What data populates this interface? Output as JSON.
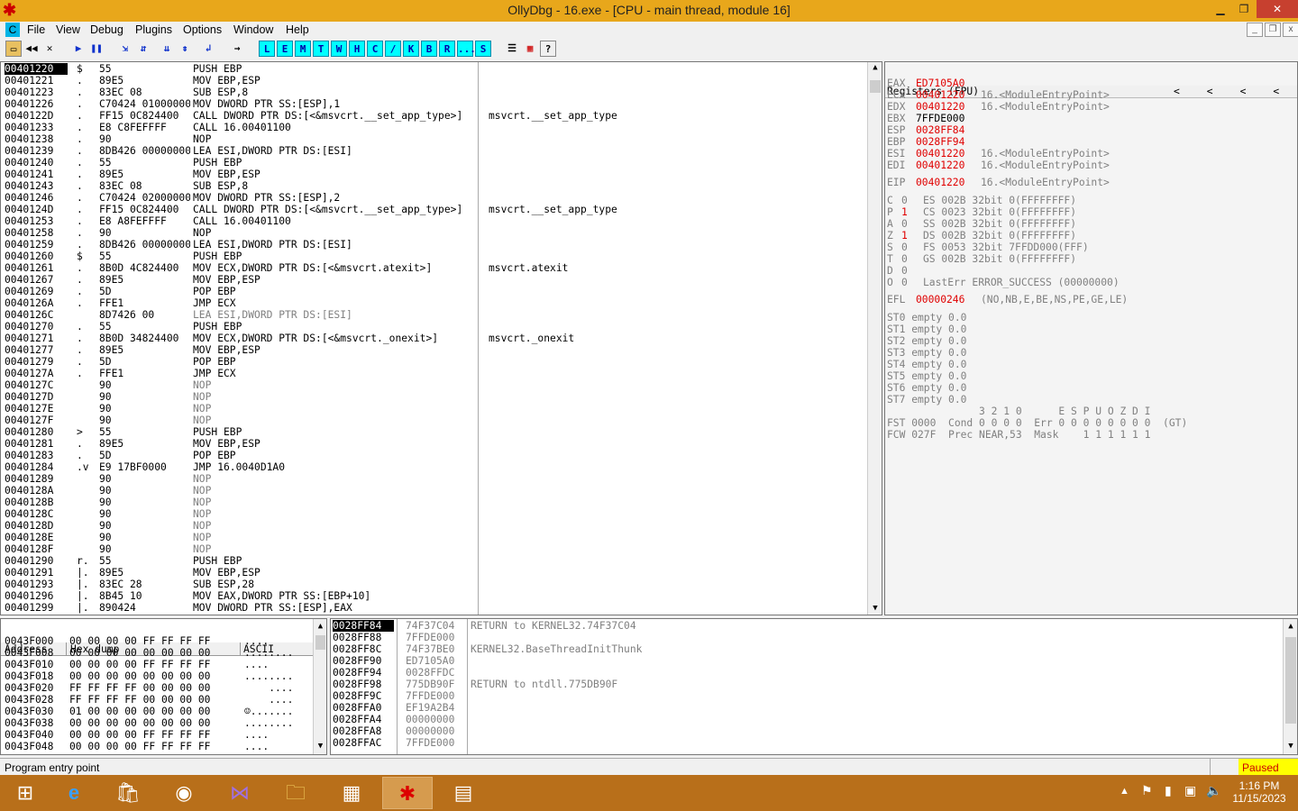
{
  "window": {
    "title": "OllyDbg - 16.exe - [CPU - main thread, module 16]"
  },
  "menu": [
    "File",
    "View",
    "Debug",
    "Plugins",
    "Options",
    "Window",
    "Help"
  ],
  "toolbar": {
    "letters": [
      "L",
      "E",
      "M",
      "T",
      "W",
      "H",
      "C",
      "/",
      "K",
      "B",
      "R",
      "...",
      "S"
    ]
  },
  "disasm": [
    [
      "00401220",
      "$",
      "55",
      "PUSH EBP",
      "",
      true
    ],
    [
      "00401221",
      ".",
      "89E5",
      "MOV EBP,ESP",
      "",
      false
    ],
    [
      "00401223",
      ".",
      "83EC 08",
      "SUB ESP,8",
      "",
      false
    ],
    [
      "00401226",
      ".",
      "C70424 01000000",
      "MOV DWORD PTR SS:[ESP],1",
      "",
      false
    ],
    [
      "0040122D",
      ".",
      "FF15 0C824400",
      "CALL DWORD PTR DS:[<&msvcrt.__set_app_type>]",
      "msvcrt.__set_app_type",
      false
    ],
    [
      "00401233",
      ".",
      "E8 C8FEFFFF",
      "CALL 16.00401100",
      "",
      false
    ],
    [
      "00401238",
      ".",
      "90",
      "NOP",
      "",
      false
    ],
    [
      "00401239",
      ".",
      "8DB426 00000000",
      "LEA ESI,DWORD PTR DS:[ESI]",
      "",
      false
    ],
    [
      "00401240",
      ".",
      "55",
      "PUSH EBP",
      "",
      false
    ],
    [
      "00401241",
      ".",
      "89E5",
      "MOV EBP,ESP",
      "",
      false
    ],
    [
      "00401243",
      ".",
      "83EC 08",
      "SUB ESP,8",
      "",
      false
    ],
    [
      "00401246",
      ".",
      "C70424 02000000",
      "MOV DWORD PTR SS:[ESP],2",
      "",
      false
    ],
    [
      "0040124D",
      ".",
      "FF15 0C824400",
      "CALL DWORD PTR DS:[<&msvcrt.__set_app_type>]",
      "msvcrt.__set_app_type",
      false
    ],
    [
      "00401253",
      ".",
      "E8 A8FEFFFF",
      "CALL 16.00401100",
      "",
      false
    ],
    [
      "00401258",
      ".",
      "90",
      "NOP",
      "",
      false
    ],
    [
      "00401259",
      ".",
      "8DB426 00000000",
      "LEA ESI,DWORD PTR DS:[ESI]",
      "",
      false
    ],
    [
      "00401260",
      "$",
      "55",
      "PUSH EBP",
      "",
      false
    ],
    [
      "00401261",
      ".",
      "8B0D 4C824400",
      "MOV ECX,DWORD PTR DS:[<&msvcrt.atexit>]",
      "msvcrt.atexit",
      false
    ],
    [
      "00401267",
      ".",
      "89E5",
      "MOV EBP,ESP",
      "",
      false
    ],
    [
      "00401269",
      ".",
      "5D",
      "POP EBP",
      "",
      false
    ],
    [
      "0040126A",
      ".",
      "FFE1",
      "JMP ECX",
      "",
      false
    ],
    [
      "0040126C",
      "",
      "8D7426 00",
      "LEA ESI,DWORD PTR DS:[ESI]",
      "",
      true
    ],
    [
      "00401270",
      ".",
      "55",
      "PUSH EBP",
      "",
      false
    ],
    [
      "00401271",
      ".",
      "8B0D 34824400",
      "MOV ECX,DWORD PTR DS:[<&msvcrt._onexit>]",
      "msvcrt._onexit",
      false
    ],
    [
      "00401277",
      ".",
      "89E5",
      "MOV EBP,ESP",
      "",
      false
    ],
    [
      "00401279",
      ".",
      "5D",
      "POP EBP",
      "",
      false
    ],
    [
      "0040127A",
      ".",
      "FFE1",
      "JMP ECX",
      "",
      false
    ],
    [
      "0040127C",
      "",
      "90",
      "NOP",
      "",
      true
    ],
    [
      "0040127D",
      "",
      "90",
      "NOP",
      "",
      true
    ],
    [
      "0040127E",
      "",
      "90",
      "NOP",
      "",
      true
    ],
    [
      "0040127F",
      "",
      "90",
      "NOP",
      "",
      true
    ],
    [
      "00401280",
      ">",
      "55",
      "PUSH EBP",
      "",
      false
    ],
    [
      "00401281",
      ".",
      "89E5",
      "MOV EBP,ESP",
      "",
      false
    ],
    [
      "00401283",
      ".",
      "5D",
      "POP EBP",
      "",
      false
    ],
    [
      "00401284",
      ".v",
      "E9 17BF0000",
      "JMP 16.0040D1A0",
      "",
      false
    ],
    [
      "00401289",
      "",
      "90",
      "NOP",
      "",
      true
    ],
    [
      "0040128A",
      "",
      "90",
      "NOP",
      "",
      true
    ],
    [
      "0040128B",
      "",
      "90",
      "NOP",
      "",
      true
    ],
    [
      "0040128C",
      "",
      "90",
      "NOP",
      "",
      true
    ],
    [
      "0040128D",
      "",
      "90",
      "NOP",
      "",
      true
    ],
    [
      "0040128E",
      "",
      "90",
      "NOP",
      "",
      true
    ],
    [
      "0040128F",
      "",
      "90",
      "NOP",
      "",
      true
    ],
    [
      "00401290",
      "r.",
      "55",
      "PUSH EBP",
      "",
      false
    ],
    [
      "00401291",
      "|.",
      "89E5",
      "MOV EBP,ESP",
      "",
      false
    ],
    [
      "00401293",
      "|.",
      "83EC 28",
      "SUB ESP,28",
      "",
      false
    ],
    [
      "00401296",
      "|.",
      "8B45 10",
      "MOV EAX,DWORD PTR SS:[EBP+10]",
      "",
      false
    ],
    [
      "00401299",
      "|.",
      "890424",
      "MOV DWORD PTR SS:[ESP],EAX",
      "",
      false
    ]
  ],
  "registers": {
    "header": "Registers (FPU)",
    "gp": [
      [
        "EAX",
        "ED7105A0",
        ""
      ],
      [
        "ECX",
        "00401220",
        "16.<ModuleEntryPoint>"
      ],
      [
        "EDX",
        "00401220",
        "16.<ModuleEntryPoint>"
      ],
      [
        "EBX",
        "7FFDE000",
        ""
      ],
      [
        "ESP",
        "0028FF84",
        ""
      ],
      [
        "EBP",
        "0028FF94",
        ""
      ],
      [
        "ESI",
        "00401220",
        "16.<ModuleEntryPoint>"
      ],
      [
        "EDI",
        "00401220",
        "16.<ModuleEntryPoint>"
      ]
    ],
    "gp_red": [
      true,
      true,
      true,
      false,
      true,
      true,
      true,
      true
    ],
    "eip": [
      "EIP",
      "00401220",
      "16.<ModuleEntryPoint>"
    ],
    "flags": [
      [
        "C",
        "0",
        "ES 002B 32bit 0(FFFFFFFF)",
        false
      ],
      [
        "P",
        "1",
        "CS 0023 32bit 0(FFFFFFFF)",
        true
      ],
      [
        "A",
        "0",
        "SS 002B 32bit 0(FFFFFFFF)",
        false
      ],
      [
        "Z",
        "1",
        "DS 002B 32bit 0(FFFFFFFF)",
        true
      ],
      [
        "S",
        "0",
        "FS 0053 32bit 7FFDD000(FFF)",
        false
      ],
      [
        "T",
        "0",
        "GS 002B 32bit 0(FFFFFFFF)",
        false
      ],
      [
        "D",
        "0",
        "",
        false
      ],
      [
        "O",
        "0",
        "LastErr ERROR_SUCCESS (00000000)",
        false
      ]
    ],
    "efl": [
      "EFL",
      "00000246",
      "(NO,NB,E,BE,NS,PE,GE,LE)"
    ],
    "fpu": [
      "ST0 empty 0.0",
      "ST1 empty 0.0",
      "ST2 empty 0.0",
      "ST3 empty 0.0",
      "ST4 empty 0.0",
      "ST5 empty 0.0",
      "ST6 empty 0.0",
      "ST7 empty 0.0"
    ],
    "fpu_hdr": "               3 2 1 0      E S P U O Z D I",
    "fst": "FST 0000  Cond 0 0 0 0  Err 0 0 0 0 0 0 0 0  (GT)",
    "fcw": "FCW 027F  Prec NEAR,53  Mask    1 1 1 1 1 1"
  },
  "dump": {
    "headers": [
      "Address",
      "Hex dump",
      "ASCII"
    ],
    "rows": [
      [
        "0043F000",
        "00 00 00 00 FF FF FF FF",
        "...."
      ],
      [
        "0043F008",
        "00 00 00 00 00 00 00 00",
        "........"
      ],
      [
        "0043F010",
        "00 00 00 00 FF FF FF FF",
        "...."
      ],
      [
        "0043F018",
        "00 00 00 00 00 00 00 00",
        "........"
      ],
      [
        "0043F020",
        "FF FF FF FF 00 00 00 00",
        "    ...."
      ],
      [
        "0043F028",
        "FF FF FF FF 00 00 00 00",
        "    ...."
      ],
      [
        "0043F030",
        "01 00 00 00 00 00 00 00",
        "☺......."
      ],
      [
        "0043F038",
        "00 00 00 00 00 00 00 00",
        "........"
      ],
      [
        "0043F040",
        "00 00 00 00 FF FF FF FF",
        "...."
      ],
      [
        "0043F048",
        "00 00 00 00 FF FF FF FF",
        "...."
      ]
    ]
  },
  "stack": [
    [
      "0028FF84",
      "74F37C04",
      "RETURN to KERNEL32.74F37C04",
      true
    ],
    [
      "0028FF88",
      "7FFDE000",
      "",
      false
    ],
    [
      "0028FF8C",
      "74F37BE0",
      "KERNEL32.BaseThreadInitThunk",
      false
    ],
    [
      "0028FF90",
      "ED7105A0",
      "",
      false
    ],
    [
      "0028FF94",
      "0028FFDC",
      "",
      false
    ],
    [
      "0028FF98",
      "775DB90F",
      "RETURN to ntdll.775DB90F",
      false
    ],
    [
      "0028FF9C",
      "7FFDE000",
      "",
      false
    ],
    [
      "0028FFA0",
      "EF19A2B4",
      "",
      false
    ],
    [
      "0028FFA4",
      "00000000",
      "",
      false
    ],
    [
      "0028FFA8",
      "00000000",
      "",
      false
    ],
    [
      "0028FFAC",
      "7FFDE000",
      "",
      false
    ]
  ],
  "status": {
    "message": "Program entry point",
    "state": "Paused"
  },
  "taskbar": {
    "time": "1:16 PM",
    "date": "11/15/2023"
  }
}
